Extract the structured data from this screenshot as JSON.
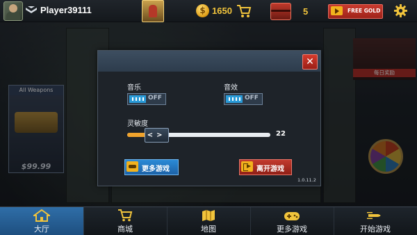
{
  "topbar": {
    "player_name": "Player39111",
    "coins": "1650",
    "chest_count": "5",
    "free_gold_label": "FREE GOLD",
    "icons": [
      "avatar",
      "rank-chevron-icon",
      "event-badge-icon",
      "coin-icon",
      "shop-cart-icon",
      "chest-icon",
      "video-ad-icon",
      "settings-gear-icon"
    ]
  },
  "background": {
    "weapons_card_title": "All Weapons",
    "weapons_card_price": "$99.99",
    "daily_label": "每日奖励"
  },
  "settings_modal": {
    "music_label": "音乐",
    "music_state": "OFF",
    "sfx_label": "音效",
    "sfx_state": "OFF",
    "sensitivity_label": "灵敏度",
    "sensitivity_value": "22",
    "sensitivity_fraction": 0.2,
    "slider_handle_glyph": "<>",
    "close_glyph": "✕",
    "more_games_label": "更多游戏",
    "exit_game_label": "离开游戏",
    "version": "1.0.11.2"
  },
  "bottom_nav": [
    {
      "label": "大厅",
      "icon": "home-icon",
      "active": true
    },
    {
      "label": "商城",
      "icon": "cart-icon",
      "active": false
    },
    {
      "label": "地图",
      "icon": "map-icon",
      "active": false
    },
    {
      "label": "更多游戏",
      "icon": "gamepad-icon",
      "active": false
    },
    {
      "label": "开始游戏",
      "icon": "bullet-icon",
      "active": false
    }
  ],
  "colors": {
    "accent_blue": "#2a9bd8",
    "slider_orange": "#f0a32c",
    "close_red": "#d43a2c",
    "gold": "#f1c43c"
  }
}
